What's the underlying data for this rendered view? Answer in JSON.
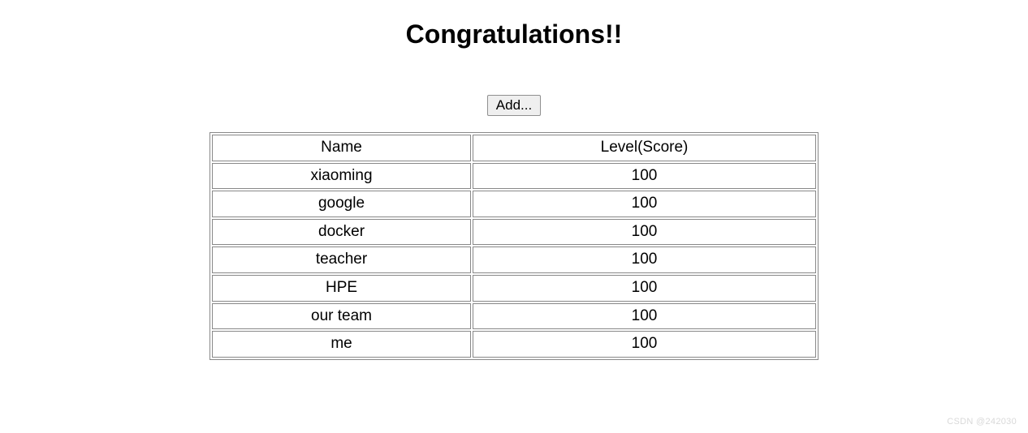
{
  "heading": "Congratulations!!",
  "add_button_label": "Add...",
  "table": {
    "headers": {
      "name": "Name",
      "score": "Level(Score)"
    },
    "rows": [
      {
        "name": "xiaoming",
        "score": "100"
      },
      {
        "name": "google",
        "score": "100"
      },
      {
        "name": "docker",
        "score": "100"
      },
      {
        "name": "teacher",
        "score": "100"
      },
      {
        "name": "HPE",
        "score": "100"
      },
      {
        "name": "our team",
        "score": "100"
      },
      {
        "name": "me",
        "score": "100"
      }
    ]
  },
  "watermark": "CSDN @242030"
}
